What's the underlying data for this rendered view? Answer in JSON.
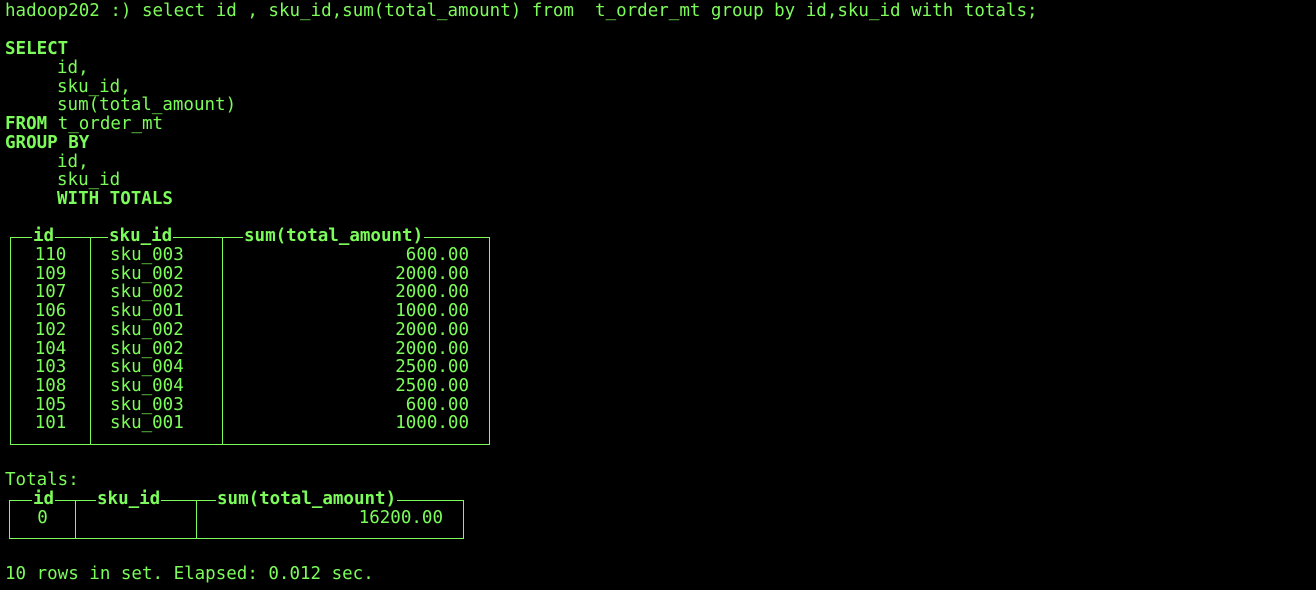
{
  "command": {
    "prompt": "hadoop202 :)",
    "text": "select id , sku_id,sum(total_amount) from  t_order_mt group by id,sku_id with totals;"
  },
  "formatted_query": {
    "select_kw": "SELECT",
    "select_cols": [
      "id,",
      "sku_id,",
      "sum(total_amount)"
    ],
    "from_kw": "FROM",
    "from_table": "t_order_mt",
    "group_kw": "GROUP BY",
    "group_cols": [
      "id,",
      "sku_id"
    ],
    "with_totals_kw": "WITH TOTALS"
  },
  "result_table": {
    "headers": [
      "id",
      "sku_id",
      "sum(total_amount)"
    ],
    "rows": [
      [
        "110",
        "sku_003",
        "600.00"
      ],
      [
        "109",
        "sku_002",
        "2000.00"
      ],
      [
        "107",
        "sku_002",
        "2000.00"
      ],
      [
        "106",
        "sku_001",
        "1000.00"
      ],
      [
        "102",
        "sku_002",
        "2000.00"
      ],
      [
        "104",
        "sku_002",
        "2000.00"
      ],
      [
        "103",
        "sku_004",
        "2500.00"
      ],
      [
        "108",
        "sku_004",
        "2500.00"
      ],
      [
        "105",
        "sku_003",
        "600.00"
      ],
      [
        "101",
        "sku_001",
        "1000.00"
      ]
    ]
  },
  "totals": {
    "label": "Totals:",
    "headers": [
      "id",
      "sku_id",
      "sum(total_amount)"
    ],
    "row": [
      "0",
      "",
      "16200.00"
    ]
  },
  "status": "10 rows in set. Elapsed: 0.012 sec.",
  "colors": {
    "background": "#000000",
    "text": "#7CFC5A"
  }
}
